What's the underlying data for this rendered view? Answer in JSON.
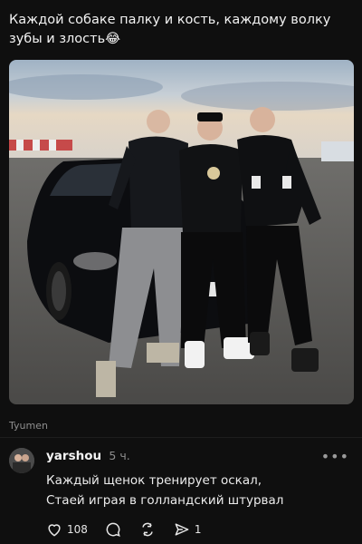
{
  "post": {
    "text": "Каждой собаке палку и кость, каждому волку зубы и злость😂",
    "location": "Tyumen"
  },
  "comment": {
    "username": "yarshou",
    "time": "5 ч.",
    "lines": [
      "Каждый щенок тренирует оскал,",
      "Стаей играя в голландский штурвал"
    ],
    "more_icon": "more-dots-icon"
  },
  "actions": {
    "likes": "108",
    "shares": "1",
    "icons": [
      "heart-icon",
      "comment-icon",
      "repost-icon",
      "send-icon"
    ]
  },
  "colors": {
    "background": "#0f0f0f",
    "muted": "#8e8e8e",
    "text": "#f3f3f3"
  }
}
